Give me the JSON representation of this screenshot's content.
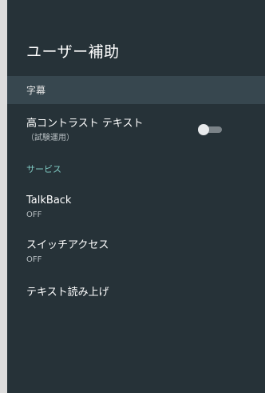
{
  "page": {
    "title": "ユーザー補助"
  },
  "items": [
    {
      "label": "字幕"
    },
    {
      "label": "高コントラスト テキスト",
      "sublabel": "（試験運用）",
      "toggle_state": "off"
    },
    {
      "section_header": "サービス"
    },
    {
      "label": "TalkBack",
      "sublabel": "OFF"
    },
    {
      "label": "スイッチアクセス",
      "sublabel": "OFF"
    },
    {
      "label": "テキスト読み上げ"
    }
  ],
  "colors": {
    "background": "#263238",
    "selected": "#37474f",
    "accent": "#80cbc4"
  }
}
